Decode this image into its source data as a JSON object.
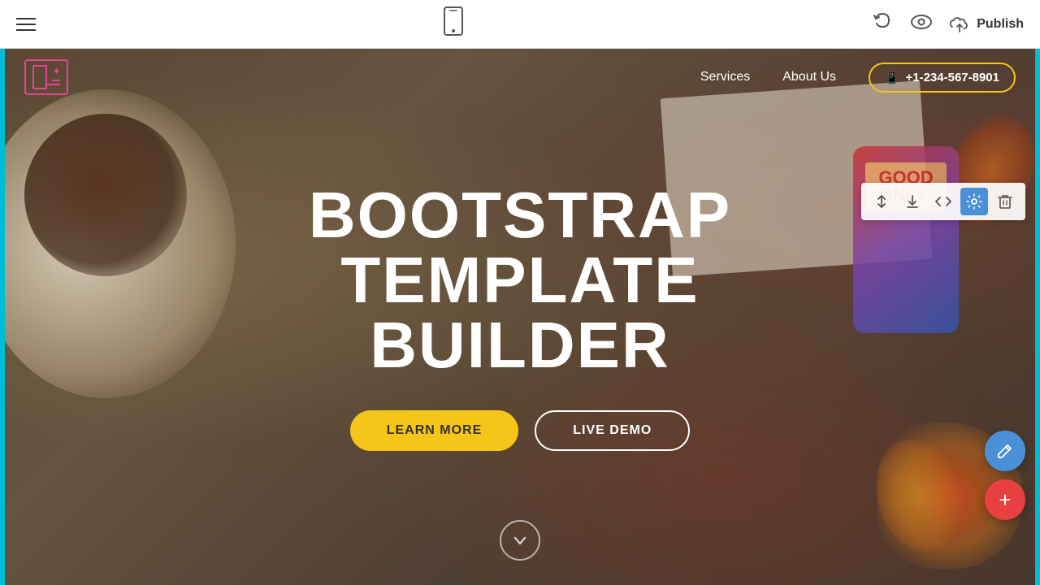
{
  "toolbar": {
    "publish_label": "Publish",
    "hamburger_title": "menu",
    "undo_symbol": "↩",
    "eye_symbol": "👁",
    "phone_symbol": "📱",
    "cloud_symbol": "☁"
  },
  "site": {
    "nav": {
      "services_label": "Services",
      "about_label": "About Us",
      "phone_number": "+1-234-567-8901",
      "phone_icon": "📱"
    },
    "hero": {
      "title_line1": "BOOTSTRAP",
      "title_line2": "TEMPLATE BUILDER",
      "learn_more_label": "LEARN MORE",
      "live_demo_label": "LIVE DEMO"
    }
  },
  "section_tools": {
    "reorder_icon": "⇅",
    "download_icon": "⬇",
    "code_icon": "</>",
    "settings_icon": "⚙",
    "delete_icon": "🗑"
  },
  "fabs": {
    "edit_icon": "✏",
    "add_icon": "+"
  }
}
